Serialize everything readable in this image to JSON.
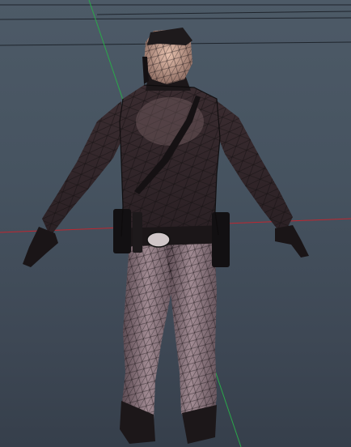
{
  "viewport": {
    "background_top": "#4d5a67",
    "background_bottom": "#363f4b",
    "grid_color": "#1a1f26",
    "axis_x_color": "#c0262f",
    "axis_y_color": "#2aa84a",
    "wireframe_color": "#111111",
    "mesh_shading": "#6b5a62",
    "mesh_highlight": "#c8a89f",
    "display_mode": "wireframe-on-shaded",
    "model": "police-officer-character-mesh"
  }
}
